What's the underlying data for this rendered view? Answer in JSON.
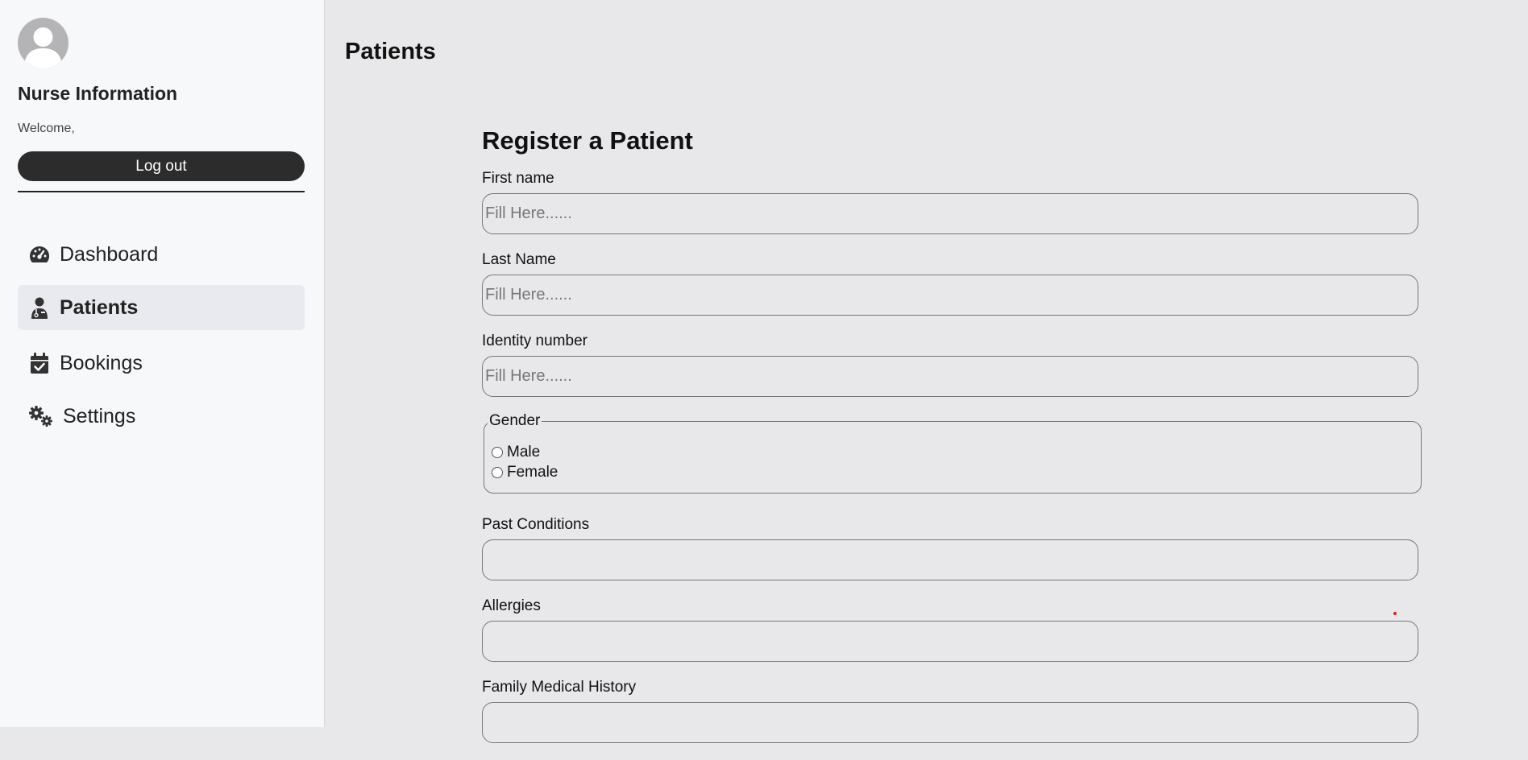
{
  "sidebar": {
    "title": "Nurse Information",
    "welcome": "Welcome,",
    "logout_label": "Log out",
    "nav": [
      {
        "label": "Dashboard",
        "icon": "gauge-icon",
        "active": false
      },
      {
        "label": "Patients",
        "icon": "user-doctor-icon",
        "active": true
      },
      {
        "label": "Bookings",
        "icon": "calendar-check-icon",
        "active": false
      },
      {
        "label": "Settings",
        "icon": "gears-icon",
        "active": false
      }
    ]
  },
  "main": {
    "page_title": "Patients",
    "form": {
      "title": "Register a Patient",
      "fields": [
        {
          "label": "First name",
          "placeholder": "Fill Here......",
          "value": ""
        },
        {
          "label": "Last Name",
          "placeholder": "Fill Here......",
          "value": ""
        },
        {
          "label": "Identity number",
          "placeholder": "Fill Here......",
          "value": ""
        }
      ],
      "gender": {
        "legend": "Gender",
        "options": [
          "Male",
          "Female"
        ],
        "selected": null
      },
      "extra_fields": [
        {
          "label": "Past Conditions",
          "placeholder": "",
          "value": ""
        },
        {
          "label": "Allergies",
          "placeholder": "",
          "value": ""
        },
        {
          "label": "Family Medical History",
          "placeholder": "",
          "value": ""
        }
      ]
    }
  },
  "colors": {
    "sidebar_bg": "#f7f8fa",
    "main_bg": "#e8e8ea",
    "button_bg": "#2c2c2c",
    "active_nav_bg": "#e9eaef"
  }
}
